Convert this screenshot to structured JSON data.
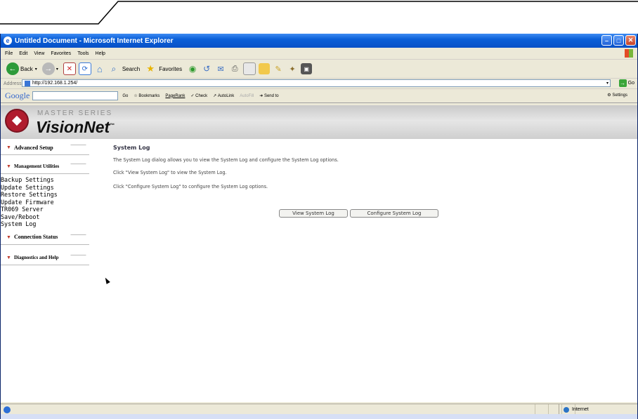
{
  "window": {
    "title": "Untitled Document - Microsoft Internet Explorer"
  },
  "menu": [
    "File",
    "Edit",
    "View",
    "Favorites",
    "Tools",
    "Help"
  ],
  "toolbar": {
    "back": "Back",
    "search": "Search",
    "favorites": "Favorites"
  },
  "address": {
    "label": "Address",
    "url": "http://192.168.1.254/",
    "go": "Go"
  },
  "google_bar": {
    "logo": "Google",
    "go": "Go",
    "bookmarks": "Bookmarks",
    "pagerank": "PageRank",
    "check": "Check",
    "autolink": "AutoLink",
    "autofill": "AutoFill",
    "send_to": "Send to",
    "settings": "Settings"
  },
  "banner": {
    "series": "MASTER SERIES",
    "brand": "VisionNet",
    "tm": "™"
  },
  "sidebar": {
    "sections": [
      "Advanced Setup",
      "Management Utilities",
      "Connection Status",
      "Diagnostics and Help"
    ],
    "links": [
      "Backup Settings",
      "Update Settings",
      "Restore Settings",
      "Update Firmware",
      "TR069 Server",
      "Save/Reboot",
      "System Log"
    ]
  },
  "main": {
    "title": "System Log",
    "desc": "The System Log dialog allows you to view the System Log and configure the System Log options.",
    "line1": "Click \"View System Log\" to view the System Log.",
    "line2": "Click \"Configure System Log\" to configure the System Log options.",
    "btn_view": "View System Log",
    "btn_config": "Configure System Log"
  },
  "status": {
    "zone": "Internet"
  },
  "colors": {
    "titlebar": "#0a5fd8",
    "chrome": "#ece9d8",
    "brand_red": "#b01c2e"
  }
}
